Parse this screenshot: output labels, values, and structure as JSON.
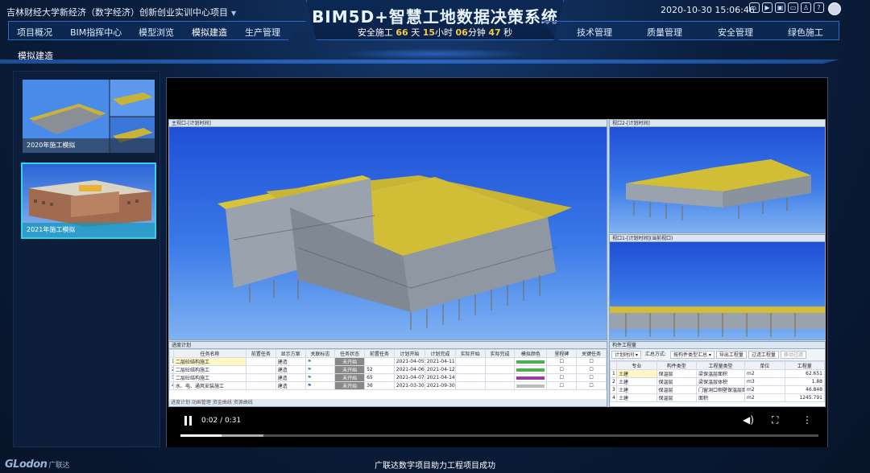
{
  "header": {
    "project": "吉林财经大学新经济（数字经济）创新创业实训中心项目",
    "system_title": "BIM5D+智慧工地数据决策系统",
    "safety": {
      "prefix": "安全施工",
      "days": "66",
      "d_unit": "天",
      "hours": "15",
      "h_unit": "小时",
      "minutes": "06",
      "m_unit": "分钟",
      "seconds": "47",
      "s_unit": "秒"
    },
    "datetime": "2020-10-30 15:06:46"
  },
  "nav_left": [
    "项目概况",
    "BIM指挥中心",
    "模型浏览",
    "模拟建造",
    "生产管理"
  ],
  "nav_right": [
    "技术管理",
    "质量管理",
    "安全管理",
    "绿色施工"
  ],
  "breadcrumb": "模拟建造",
  "thumbnails": [
    {
      "label": "2020年施工模拟"
    },
    {
      "label": "2021年施工模拟"
    }
  ],
  "app": {
    "main_view_title": "主视口-[计划时间]",
    "view2_title": "视口2-[计划时间]",
    "view1_title": "视口1-[计划时间](当前视口)",
    "schedule_title": "进度计划",
    "quantity_title": "构件工程量",
    "schedule_headers": [
      "任务名称",
      "前置任务",
      "显示方案",
      "关联标志",
      "任务状态",
      "前置任务",
      "计划开始",
      "计划完成",
      "实际开始",
      "实际完成",
      "模拟颜色",
      "里程碑",
      "关键任务"
    ],
    "schedule_rows": [
      {
        "idx": "1",
        "name": "二层砼结构施工",
        "plan": "建造",
        "status": "未开始",
        "pre": "",
        "start": "2021-04-05",
        "end": "2021-04-11",
        "color": "#4caf50"
      },
      {
        "idx": "2",
        "name": "二层砼结构施工",
        "plan": "建造",
        "status": "未开始",
        "pre": "52",
        "start": "2021-04-06",
        "end": "2021-04-12",
        "color": "#4caf50"
      },
      {
        "idx": "3",
        "name": "二层砼结构施工",
        "plan": "建造",
        "status": "未开始",
        "pre": "65",
        "start": "2021-04-07",
        "end": "2021-04-14",
        "color": "#a03ca0"
      },
      {
        "idx": "4",
        "name": "水、电、通风安装施工",
        "plan": "建造",
        "status": "未开始",
        "pre": "36",
        "start": "2021-03-30",
        "end": "2021-09-30",
        "color": "#bbbbbb"
      }
    ],
    "schedule_tabs": "进度计划  动画管理  资金曲线  资源曲线",
    "qty_toolbar": [
      "计划时间 ▾",
      "汇总方式:",
      "按构件类型汇总 ▾",
      "导出工程量",
      "过滤工程量",
      "移动过滤"
    ],
    "qty_headers": [
      "",
      "专业",
      "构件类型",
      "工程量类型",
      "单位",
      "工程量"
    ],
    "qty_rows": [
      {
        "i": "1",
        "major": "土建",
        "type": "保温层",
        "qtype": "梁保温层面积",
        "unit": "m2",
        "val": "62.651"
      },
      {
        "i": "2",
        "major": "土建",
        "type": "保温层",
        "qtype": "梁保温层体积",
        "unit": "m3",
        "val": "1.88"
      },
      {
        "i": "3",
        "major": "土建",
        "type": "保温层",
        "qtype": "门窗洞口侧壁保温层面积",
        "unit": "m2",
        "val": "46.848"
      },
      {
        "i": "4",
        "major": "土建",
        "type": "保温层",
        "qtype": "面积",
        "unit": "m2",
        "val": "1245.791"
      }
    ]
  },
  "player": {
    "time": "0:02 / 0:31",
    "progress": 0.065,
    "buffered": 0.13
  },
  "footer": {
    "logo": "GLodon",
    "logo_cn": "广联达",
    "caption": "广联达数字项目助力工程项目成功"
  }
}
